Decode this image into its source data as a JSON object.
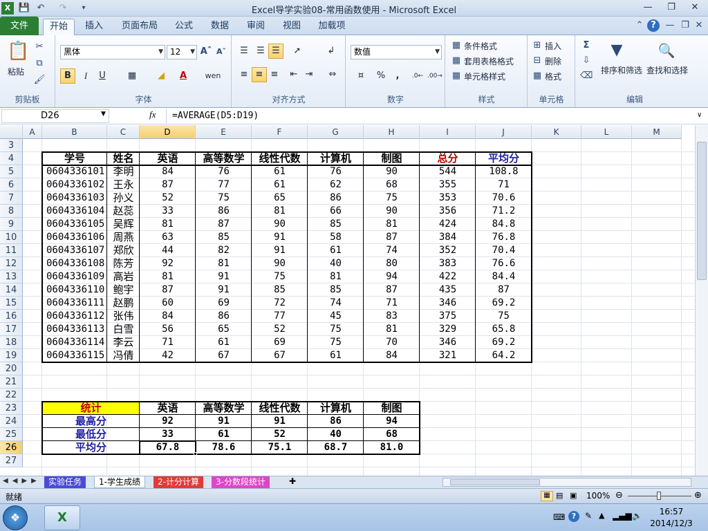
{
  "window": {
    "title": "Excel导学实验08-常用函数使用 - Microsoft Excel"
  },
  "ribbon_tabs": [
    "文件",
    "开始",
    "插入",
    "页面布局",
    "公式",
    "数据",
    "审阅",
    "视图",
    "加载项"
  ],
  "ribbon": {
    "clipboard": {
      "paste": "粘贴",
      "label": "剪贴板"
    },
    "font": {
      "name": "黑体",
      "size": "12",
      "label": "字体"
    },
    "align": {
      "label": "对齐方式"
    },
    "number": {
      "format": "数值",
      "label": "数字"
    },
    "styles": {
      "cond": "条件格式",
      "table": "套用表格格式",
      "cell": "单元格样式",
      "label": "样式"
    },
    "cells": {
      "insert": "插入",
      "delete": "删除",
      "format": "格式",
      "label": "单元格"
    },
    "edit": {
      "sort": "排序和筛选",
      "find": "查找和选择",
      "label": "编辑"
    }
  },
  "formula_bar": {
    "name_box": "D26",
    "fx": "fx",
    "formula": "=AVERAGE(D5:D19)"
  },
  "columns": [
    "A",
    "B",
    "C",
    "D",
    "E",
    "F",
    "G",
    "H",
    "I",
    "J",
    "K",
    "L",
    "M"
  ],
  "rows": [
    "3",
    "4",
    "5",
    "6",
    "7",
    "8",
    "9",
    "10",
    "11",
    "12",
    "13",
    "14",
    "15",
    "16",
    "17",
    "18",
    "19",
    "20",
    "21",
    "22",
    "23",
    "24",
    "25",
    "26",
    "27"
  ],
  "table": {
    "headers": [
      "学号",
      "姓名",
      "英语",
      "高等数学",
      "线性代数",
      "计算机",
      "制图",
      "总分",
      "平均分"
    ],
    "rows": [
      [
        "0604336101",
        "李明",
        "84",
        "76",
        "61",
        "76",
        "90",
        "544",
        "108.8"
      ],
      [
        "0604336102",
        "王永",
        "87",
        "77",
        "61",
        "62",
        "68",
        "355",
        "71"
      ],
      [
        "0604336103",
        "孙义",
        "52",
        "75",
        "65",
        "86",
        "75",
        "353",
        "70.6"
      ],
      [
        "0604336104",
        "赵蕊",
        "33",
        "86",
        "81",
        "66",
        "90",
        "356",
        "71.2"
      ],
      [
        "0604336105",
        "吴辉",
        "81",
        "87",
        "90",
        "85",
        "81",
        "424",
        "84.8"
      ],
      [
        "0604336106",
        "周燕",
        "63",
        "85",
        "91",
        "58",
        "87",
        "384",
        "76.8"
      ],
      [
        "0604336107",
        "郑欣",
        "44",
        "82",
        "91",
        "61",
        "74",
        "352",
        "70.4"
      ],
      [
        "0604336108",
        "陈芳",
        "92",
        "81",
        "90",
        "40",
        "80",
        "383",
        "76.6"
      ],
      [
        "0604336109",
        "高岩",
        "81",
        "91",
        "75",
        "81",
        "94",
        "422",
        "84.4"
      ],
      [
        "0604336110",
        "鲍宇",
        "87",
        "91",
        "85",
        "85",
        "87",
        "435",
        "87"
      ],
      [
        "0604336111",
        "赵鹏",
        "60",
        "69",
        "72",
        "74",
        "71",
        "346",
        "69.2"
      ],
      [
        "0604336112",
        "张伟",
        "84",
        "86",
        "77",
        "45",
        "83",
        "375",
        "75"
      ],
      [
        "0604336113",
        "白雪",
        "56",
        "65",
        "52",
        "75",
        "81",
        "329",
        "65.8"
      ],
      [
        "0604336114",
        "李云",
        "71",
        "61",
        "69",
        "75",
        "70",
        "346",
        "69.2"
      ],
      [
        "0604336115",
        "冯倩",
        "42",
        "67",
        "67",
        "61",
        "84",
        "321",
        "64.2"
      ]
    ]
  },
  "stats": {
    "headers": [
      "统计",
      "英语",
      "高等数学",
      "线性代数",
      "计算机",
      "制图"
    ],
    "rows": [
      [
        "最高分",
        "92",
        "91",
        "91",
        "86",
        "94"
      ],
      [
        "最低分",
        "33",
        "61",
        "52",
        "40",
        "68"
      ],
      [
        "平均分",
        "67.8",
        "78.6",
        "75.1",
        "68.7",
        "81.0"
      ]
    ]
  },
  "sheet_tabs": [
    "实验任务",
    "1-学生成绩",
    "2-计分计算",
    "3-分数段统计"
  ],
  "status": {
    "ready": "就绪",
    "zoom": "100%"
  },
  "taskbar": {
    "time": "16:57",
    "date": "2014/12/3"
  },
  "colors": {
    "accent_green": "#2a7f33",
    "yellow": "#ffff00",
    "red_text": "#c00000",
    "blue_text": "#1f1fa0",
    "selected_header": "#f6cf6e"
  }
}
